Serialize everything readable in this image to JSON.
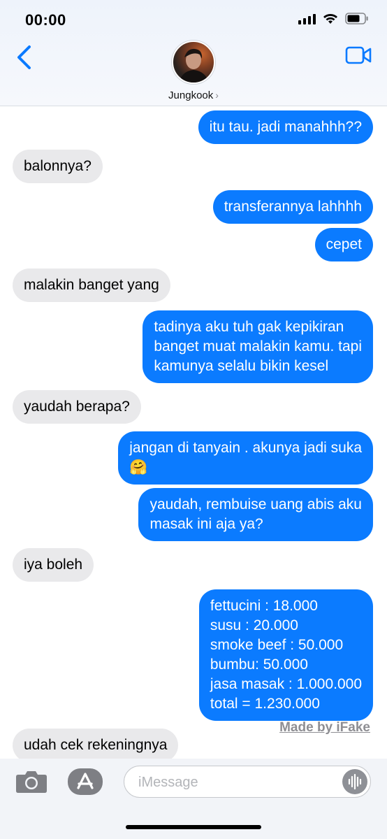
{
  "status_bar": {
    "time": "00:00"
  },
  "header": {
    "contact_name": "Jungkook",
    "chevron": "›"
  },
  "messages": [
    {
      "side": "out",
      "text": "itu tau. jadi manahhh??"
    },
    {
      "side": "in",
      "text": "balonnya?"
    },
    {
      "side": "out",
      "text": "transferannya lahhhh"
    },
    {
      "side": "out",
      "text": "cepet"
    },
    {
      "side": "in",
      "text": "malakin banget yang"
    },
    {
      "side": "out",
      "text": "tadinya aku tuh gak kepikiran\nbanget muat malakin kamu. tapi\nkamunya selalu bikin kesel"
    },
    {
      "side": "in",
      "text": "yaudah berapa?"
    },
    {
      "side": "out",
      "text": "jangan di tanyain . akunya jadi suka\n🤗"
    },
    {
      "side": "out",
      "text": "yaudah, rembuise uang abis aku\nmasak ini aja ya?"
    },
    {
      "side": "in",
      "text": "iya boleh"
    },
    {
      "side": "out",
      "text": "fettucini : 18.000\nsusu : 20.000\nsmoke beef : 50.000\nbumbu: 50.000\njasa masak : 1.000.000\ntotal = 1.230.000"
    },
    {
      "side": "in",
      "text": "udah cek rekeningnya"
    }
  ],
  "watermark": "Made by iFake",
  "input": {
    "placeholder": "iMessage"
  },
  "colors": {
    "outgoing": "#0b7bff",
    "incoming": "#e9e9eb",
    "accent": "#0a7aff"
  },
  "icons": [
    "back-chevron-icon",
    "video-call-icon",
    "camera-icon",
    "app-store-icon",
    "audio-waveform-icon",
    "signal-icon",
    "wifi-icon",
    "battery-icon"
  ]
}
